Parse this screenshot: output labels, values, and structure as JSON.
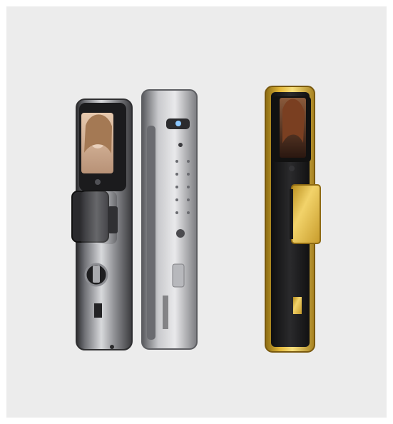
{
  "image": {
    "kind": "product-photo",
    "subject": "smart-door-locks",
    "background_color": "#ececec",
    "products": [
      {
        "id": "lock-front-chrome",
        "finish": "dark-chrome",
        "has_face_screen": true,
        "has_keyhole": true
      },
      {
        "id": "lock-side-chrome",
        "finish": "silver",
        "has_keypad": true,
        "has_camera": true
      },
      {
        "id": "lock-front-gold",
        "finish": "black-gold",
        "has_face_screen": true,
        "has_keyhole": true
      }
    ]
  }
}
